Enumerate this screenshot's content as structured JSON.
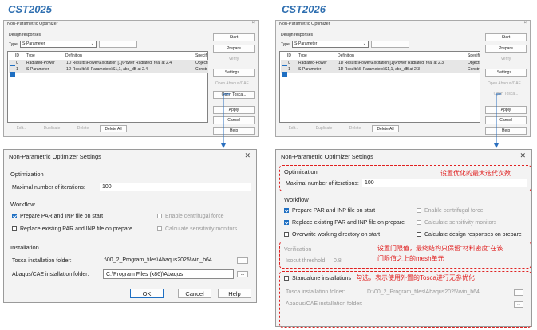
{
  "left_title": "CST2025",
  "right_title": "CST2026",
  "optimizer": {
    "title": "Non-Parametric Optimizer",
    "close": "×",
    "design_responses_label": "Design responses",
    "type_label": "Type:",
    "type_value": "S-Parameter",
    "add_response": "Add response...",
    "columns": [
      "ID",
      "Type",
      "Definition",
      "Specifi"
    ],
    "buttons": {
      "start": "Start",
      "prepare": "Prepare",
      "verify": "Verify",
      "settings": "Settings...",
      "open_abaqus": "Open Abaqus/CAE...",
      "open_tosca": "Open Tosca...",
      "apply": "Apply",
      "cancel": "Cancel",
      "help": "Help",
      "edit": "Edit...",
      "duplicate": "Duplicate",
      "delete": "Delete",
      "delete_all": "Delete All"
    }
  },
  "left_rows": [
    {
      "id": "0",
      "type": "Radiated-Power",
      "definition": "1D Results\\Power\\Excitation [1]\\Power Radiated, real at 2.4",
      "spec": "Objecti"
    },
    {
      "id": "1",
      "type": "S-Parameter",
      "definition": "1D Results\\S-Parameters\\S1,1, abs_dB at 2.4",
      "spec": "Constr"
    }
  ],
  "right_rows": [
    {
      "id": "0",
      "type": "Radiated-Power",
      "definition": "1D Results\\Power\\Excitation [1]\\Power Radiated, real at 2.3",
      "spec": "Objecti"
    },
    {
      "id": "1",
      "type": "S-Parameter",
      "definition": "1D Results\\S-Parameters\\S1,1, abs_dB at 2.3",
      "spec": "Constr"
    }
  ],
  "settings": {
    "title": "Non-Parametric Optimizer Settings",
    "close": "✕",
    "optimization": "Optimization",
    "max_iter_label": "Maximal number of iterations:",
    "max_iter_value": "100",
    "workflow": "Workflow",
    "prepare_par": "Prepare PAR and INP file on start",
    "replace_par": "Replace existing PAR and INP file on prepare",
    "enable_centrifugal": "Enable centrifugal force",
    "calc_sensitivity": "Calculate sensitivity monitors",
    "overwrite_dir": "Overwrite working directory on start",
    "calc_design": "Calculate design responses on prepare",
    "verification": "Verification",
    "isocut_label": "Isocut threshold:",
    "isocut_value": "0.8",
    "installation": "Installation",
    "standalone": "Standalone installations",
    "tosca_label_left": "Tosca installation folder:",
    "tosca_value_left": ":\\00_2_Program_files\\Abaqus2025\\win_b64",
    "abaqus_label_left": "Abaqus/CAE installation folder:",
    "abaqus_value_left": "C:\\Program Files (x86)\\Abaqus",
    "tosca_label_right": "Tosca installation folder:",
    "tosca_value_right": "D:\\00_2_Program_files\\Abaqus2025\\win_b64",
    "abaqus_label_right": "Abaqus/CAE installation folder:",
    "dots": "...",
    "ok": "OK",
    "cancel": "Cancel",
    "help": "Help"
  },
  "annotations": {
    "iterations": "设置优化的最大迭代次数",
    "threshold_line1": "设置门限值，最终结构只保留“材料密度”在该",
    "threshold_line2": "门限值之上的mesh单元",
    "standalone": "勾选，表示使用外置的Tosca进行无参优化"
  }
}
